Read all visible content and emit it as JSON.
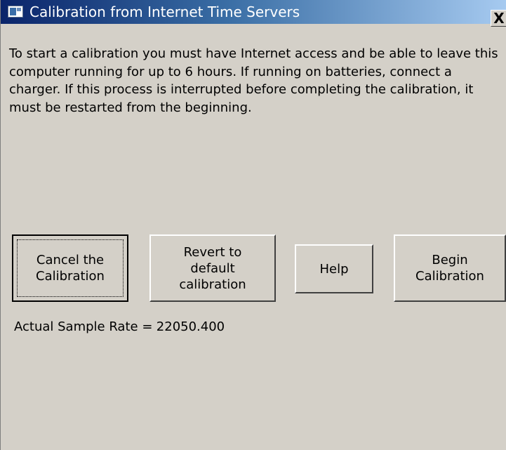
{
  "window": {
    "title": "Calibration from Internet Time Servers",
    "close_glyph": "X",
    "title_icon": "window-app-icon"
  },
  "content": {
    "instructions": "To start a calibration you must have Internet access and be able to leave this computer running for up to 6 hours.  If running on batteries, connect a charger. If this process is interrupted before completing the calibration, it must be restarted from the beginning."
  },
  "buttons": {
    "cancel": {
      "line1": "Cancel the",
      "line2": "Calibration"
    },
    "revert": {
      "line1": "Revert to",
      "line2": "default",
      "line3": "calibration"
    },
    "help": {
      "label": "Help"
    },
    "begin": {
      "line1": "Begin",
      "line2": "Calibration"
    }
  },
  "status": {
    "sample_rate_label": "Actual Sample Rate =",
    "sample_rate_value": "22050.400"
  },
  "colors": {
    "window_bg": "#d4d0c8",
    "titlebar_start": "#0a246a",
    "titlebar_end": "#a6caf0",
    "title_text": "#ffffff"
  }
}
